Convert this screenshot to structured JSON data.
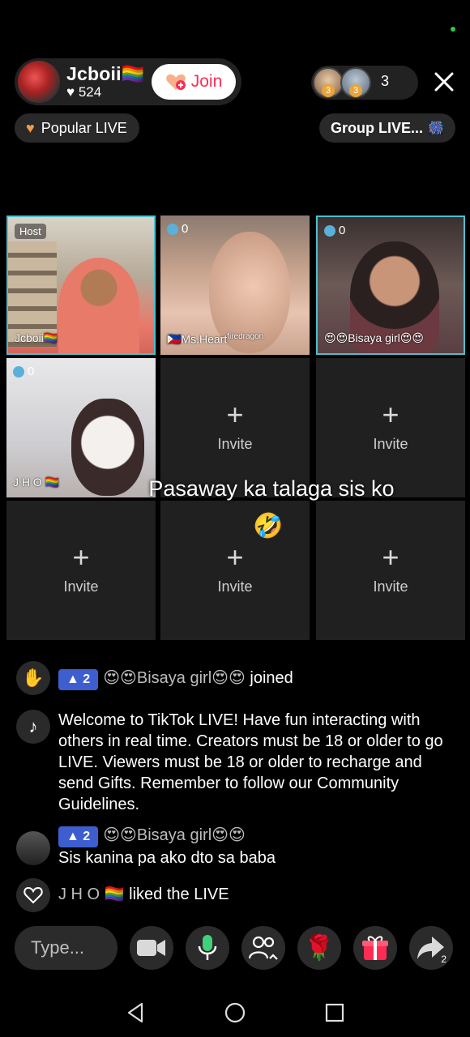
{
  "header": {
    "host_name": "Jcboii🏳️‍🌈",
    "likes": "524",
    "join_label": "Join",
    "viewer_badge_1": "3",
    "viewer_badge_2": "3",
    "viewer_count": "3",
    "popular_label": "Popular LIVE",
    "group_label": "Group LIVE..."
  },
  "grid": {
    "tiles": [
      {
        "tag": "Host",
        "label": "Jcboii🏳️‍🌈"
      },
      {
        "tag": "0",
        "label": "🇵🇭Ms.Heart",
        "label_sup": "firedragon"
      },
      {
        "tag": "0",
        "label": "😍😍Bisaya girl😍😍"
      },
      {
        "tag": "0",
        "label": "J H O 🏳️‍🌈"
      }
    ],
    "invite_label": "Invite"
  },
  "caption": {
    "text": "Pasaway ka talaga sis ko",
    "emoji": "🤣"
  },
  "chat": {
    "join_event": {
      "level": "2",
      "user": "😍😍Bisaya girl😍😍",
      "action": "joined"
    },
    "welcome": "Welcome to TikTok LIVE! Have fun interacting with others in real time. Creators must be 18 or older to go LIVE. Viewers must be 18 or older to recharge and send Gifts. Remember to follow our Community Guidelines.",
    "message": {
      "level": "2",
      "user": "😍😍Bisaya girl😍😍",
      "text": "Sis kanina pa ako dto sa baba"
    },
    "like_event": {
      "user": "J H O 🏳️‍🌈",
      "action": "liked the LIVE"
    }
  },
  "bottom": {
    "type_placeholder": "Type...",
    "share_count": "2"
  },
  "colors": {
    "accent": "#fe2c55",
    "level_badge": "#3e5ed0",
    "background": "#000000"
  },
  "icons": [
    "wave-icon",
    "tiktok-icon",
    "heart-outline-icon",
    "camera-icon",
    "mic-icon",
    "guests-icon",
    "rose-gift-icon",
    "gift-icon",
    "share-icon",
    "close-icon",
    "back-nav-icon",
    "home-nav-icon",
    "recents-nav-icon"
  ]
}
